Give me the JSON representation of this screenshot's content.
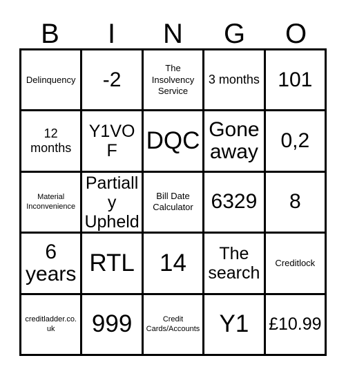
{
  "card": {
    "type": "bingo-card",
    "columns": 5,
    "rows": 5,
    "border_color": "#000000",
    "background_color": "#ffffff",
    "text_color": "#000000"
  },
  "header": {
    "letters": [
      "B",
      "I",
      "N",
      "G",
      "O"
    ]
  },
  "grid": {
    "cells": [
      [
        {
          "text": "Delinquency",
          "size": "xs"
        },
        {
          "text": "-2",
          "size": "lg"
        },
        {
          "text": "The Insolvency Service",
          "size": "xs"
        },
        {
          "text": "3 months",
          "size": "sm"
        },
        {
          "text": "101",
          "size": "lg"
        }
      ],
      [
        {
          "text": "12 months",
          "size": "sm"
        },
        {
          "text": "Y1VOF",
          "size": "md"
        },
        {
          "text": "DQC",
          "size": "xl"
        },
        {
          "text": "Gone away",
          "size": "lg"
        },
        {
          "text": "0,2",
          "size": "lg"
        }
      ],
      [
        {
          "text": "Material Inconvenience",
          "size": "xxs"
        },
        {
          "text": "Partially Upheld",
          "size": "md"
        },
        {
          "text": "Bill Date Calculator",
          "size": "xs"
        },
        {
          "text": "6329",
          "size": "lg"
        },
        {
          "text": "8",
          "size": "lg"
        }
      ],
      [
        {
          "text": "6 years",
          "size": "lg"
        },
        {
          "text": "RTL",
          "size": "xl"
        },
        {
          "text": "14",
          "size": "xl"
        },
        {
          "text": "The search",
          "size": "md"
        },
        {
          "text": "Creditlock",
          "size": "xs"
        }
      ],
      [
        {
          "text": "creditladder.co.uk",
          "size": "xxs"
        },
        {
          "text": "999",
          "size": "xl"
        },
        {
          "text": "Credit Cards/Accounts",
          "size": "xxs"
        },
        {
          "text": "Y1",
          "size": "xl"
        },
        {
          "text": "£10.99",
          "size": "md"
        }
      ]
    ]
  }
}
